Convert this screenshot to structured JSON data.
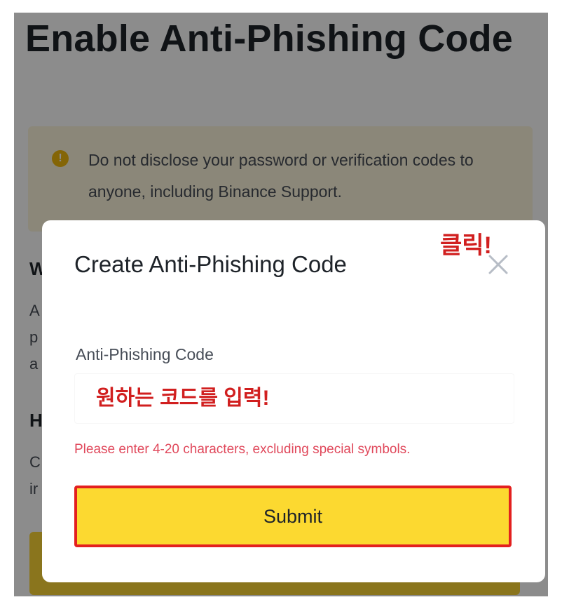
{
  "page": {
    "title": "Enable Anti-Phishing Code",
    "warning_text": "Do not disclose your password or verification codes to anyone, including Binance Support.",
    "warning_icon": "exclamation-circle-icon",
    "background_fragments": {
      "heading_1": "W",
      "text_1": "A\np\na",
      "heading_2": "H",
      "text_2": "C\nir"
    }
  },
  "modal": {
    "title": "Create Anti-Phishing Code",
    "close_icon": "close-icon",
    "field_label": "Anti-Phishing Code",
    "input_value": "",
    "input_placeholder": "원하는 코드를 입력!",
    "hint": "Please enter 4-20 characters, excluding special symbols.",
    "submit_label": "Submit"
  },
  "annotation": {
    "click_label": "클릭!"
  },
  "colors": {
    "brand_yellow": "#fcd930",
    "warning_bg": "#fdf6dc",
    "warning_icon": "#f0b90b",
    "annotation_red": "#d11f1f",
    "hint_red": "#e0485b"
  }
}
